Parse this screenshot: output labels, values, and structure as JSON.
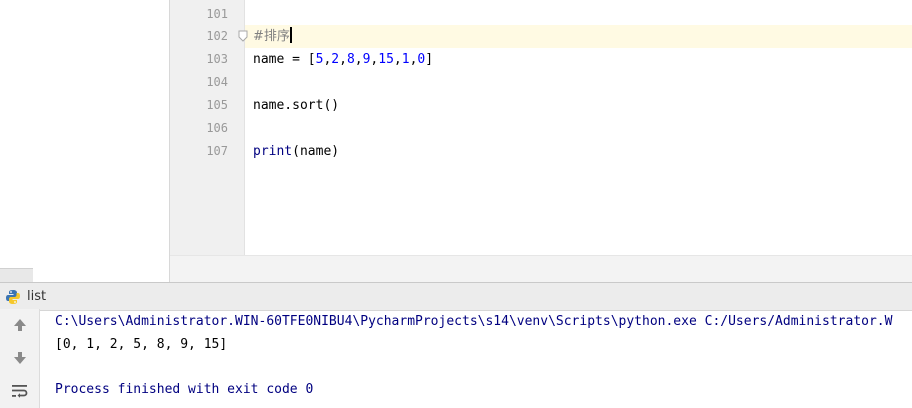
{
  "editor": {
    "line_numbers": [
      "101",
      "102",
      "103",
      "104",
      "105",
      "106",
      "107"
    ],
    "lines": {
      "l102": {
        "comment": "#排序"
      },
      "l103": {
        "prefix": "name = [",
        "nums": [
          "5",
          "2",
          "8",
          "9",
          "15",
          "1",
          "0"
        ],
        "suffix": "]"
      },
      "l105": {
        "text": "name.sort()"
      },
      "l107": {
        "fn": "print",
        "args": "(name)"
      }
    }
  },
  "run_panel": {
    "tab_label": "list",
    "console": {
      "command": "C:\\Users\\Administrator.WIN-60TFE0NIBU4\\PycharmProjects\\s14\\venv\\Scripts\\python.exe C:/Users/Administrator.W",
      "output": "[0, 1, 2, 5, 8, 9, 15]",
      "exit_message": "Process finished with exit code 0"
    },
    "toolbar_icons": [
      "arrow-up-icon",
      "arrow-down-icon",
      "soft-wrap-icon"
    ]
  },
  "colors": {
    "command": "#000080",
    "output": "#000000",
    "exit_message": "#000080",
    "current_line": "#fffae3"
  }
}
